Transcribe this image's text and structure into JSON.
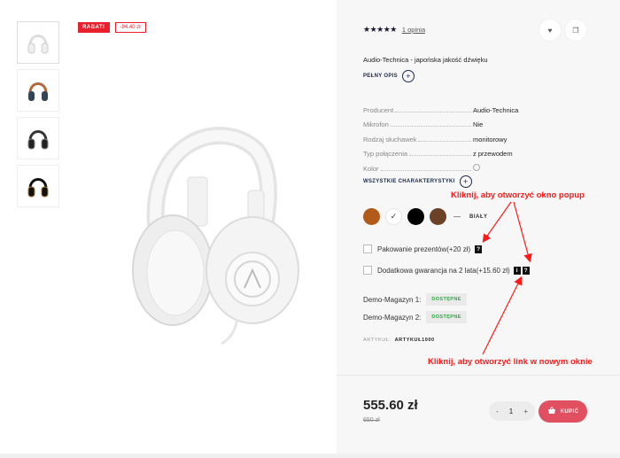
{
  "badges": {
    "discount_label": "RABAT!",
    "discount_amount": "-94.40 zł"
  },
  "thumbnails": [
    {
      "name": "headphones-white"
    },
    {
      "name": "headphones-brown"
    },
    {
      "name": "headphones-dark"
    },
    {
      "name": "headphones-black"
    }
  ],
  "rating": {
    "stars": "★★★★★",
    "reviews_label": "1 opinia"
  },
  "product": {
    "subtitle": "Audio-Technica - japońska jakość dźwięku",
    "full_desc_label": "PEŁNY OPIS",
    "all_specs_label": "WSZYSTKIE CHARAKTERYSTYKI"
  },
  "specs": [
    {
      "label": "Producent",
      "value": "Audio-Technica"
    },
    {
      "label": "Mikrofon",
      "value": "Nie"
    },
    {
      "label": "Rodzaj słuchawek",
      "value": "monitorowy"
    },
    {
      "label": "Typ połączenia",
      "value": "z przewodem"
    },
    {
      "label": "Kolor",
      "value": ""
    }
  ],
  "colors": {
    "options": [
      "#b25a1a",
      "#ffffff",
      "#000000",
      "#6b4226"
    ],
    "selected_name": "BIAŁY",
    "dash": "—",
    "check": "✓"
  },
  "addons": [
    {
      "label": "Pakowanie prezentów(+20 zł)"
    },
    {
      "label": "Dodatkowa gwarancja na 2 lata(+15.60 zł)"
    }
  ],
  "icons": {
    "question": "?",
    "info": "i",
    "plus": "+",
    "heart": "♥",
    "copy": "❐",
    "basket": "🧺"
  },
  "stock": [
    {
      "label": "Demo-Magazyn 1:",
      "status": "DOSTĘPNE"
    },
    {
      "label": "Demo-Magazyn 2:",
      "status": "DOSTĘPNE"
    }
  ],
  "article": {
    "label": "ARTYKUŁ:",
    "value": "ARTYKUŁ1000"
  },
  "annotations": {
    "popup": "Kliknij, aby otworzyć okno popup",
    "link": "Kliknij, aby otworzyć link w nowym oknie"
  },
  "purchase": {
    "price": "555.60 zł",
    "old_price": "650 zł",
    "qty_minus": "-",
    "qty_value": "1",
    "qty_plus": "+",
    "buy_label": "KUPIĆ"
  },
  "theme": {
    "accent": "#e05060",
    "discount": "#e8202e",
    "annotation": "#ff1a1a",
    "stock_ok": "#2eaa3e"
  }
}
